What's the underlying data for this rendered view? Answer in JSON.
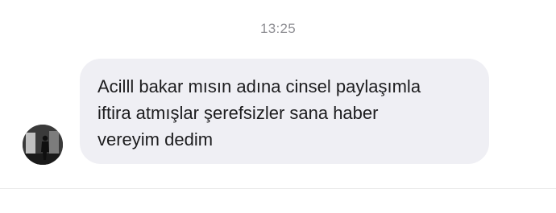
{
  "conversation": {
    "timestamp": "13:25",
    "messages": [
      {
        "direction": "incoming",
        "text": "Acilll bakar mısın adına cinsel paylaşımla\niftira atmışlar şerefsizler sana haber\nvereyim dedim"
      }
    ]
  },
  "colors": {
    "background": "#ffffff",
    "bubble": "#efeff4",
    "timestamp": "#8e8e93",
    "text": "#1c1c1e"
  },
  "icons": {
    "sender_avatar": "profile-photo"
  }
}
